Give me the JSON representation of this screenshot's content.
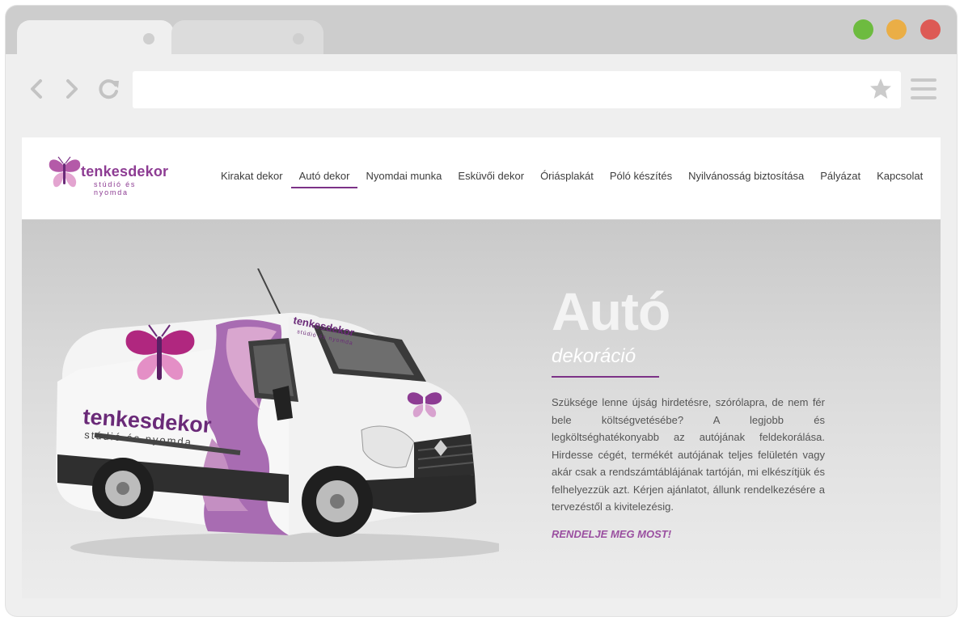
{
  "browser": {
    "url": "",
    "colors": {
      "green": "#6dbb3f",
      "yellow": "#eaae46",
      "red": "#dd5a55"
    }
  },
  "site": {
    "logo": {
      "name": "tenkesdekor",
      "tagline": "stúdió és nyomda"
    },
    "nav": [
      {
        "label": "Kirakat dekor",
        "active": false
      },
      {
        "label": "Autó dekor",
        "active": true
      },
      {
        "label": "Nyomdai munka",
        "active": false
      },
      {
        "label": "Esküvői dekor",
        "active": false
      },
      {
        "label": "Óriásplakát",
        "active": false
      },
      {
        "label": "Póló készítés",
        "active": false
      },
      {
        "label": "Nyilvánosság biztosítása",
        "active": false
      },
      {
        "label": "Pályázat",
        "active": false
      },
      {
        "label": "Kapcsolat",
        "active": false
      }
    ],
    "accent": "#7c3287"
  },
  "hero": {
    "title": "Autó",
    "subtitle": "dekoráció",
    "body": "Szüksége lenne újság hirdetésre, szórólapra, de nem fér bele költségvetésébe? A legjobb és legköltséghatékonyabb az autójának feldekorálása. Hirdesse cégét, termékét autójának teljes felületén vagy akár csak a rendszámtáblájának tartóján, mi elkészítjük és felhelyezzük azt. Kérjen ajánlatot, állunk rendelkezésére a tervezéstől a kivitelezésig.",
    "cta": "RENDELJE MEG MOST!",
    "van_branding": {
      "name": "tenkesdekor",
      "tagline": "stúdió és nyomda"
    }
  }
}
